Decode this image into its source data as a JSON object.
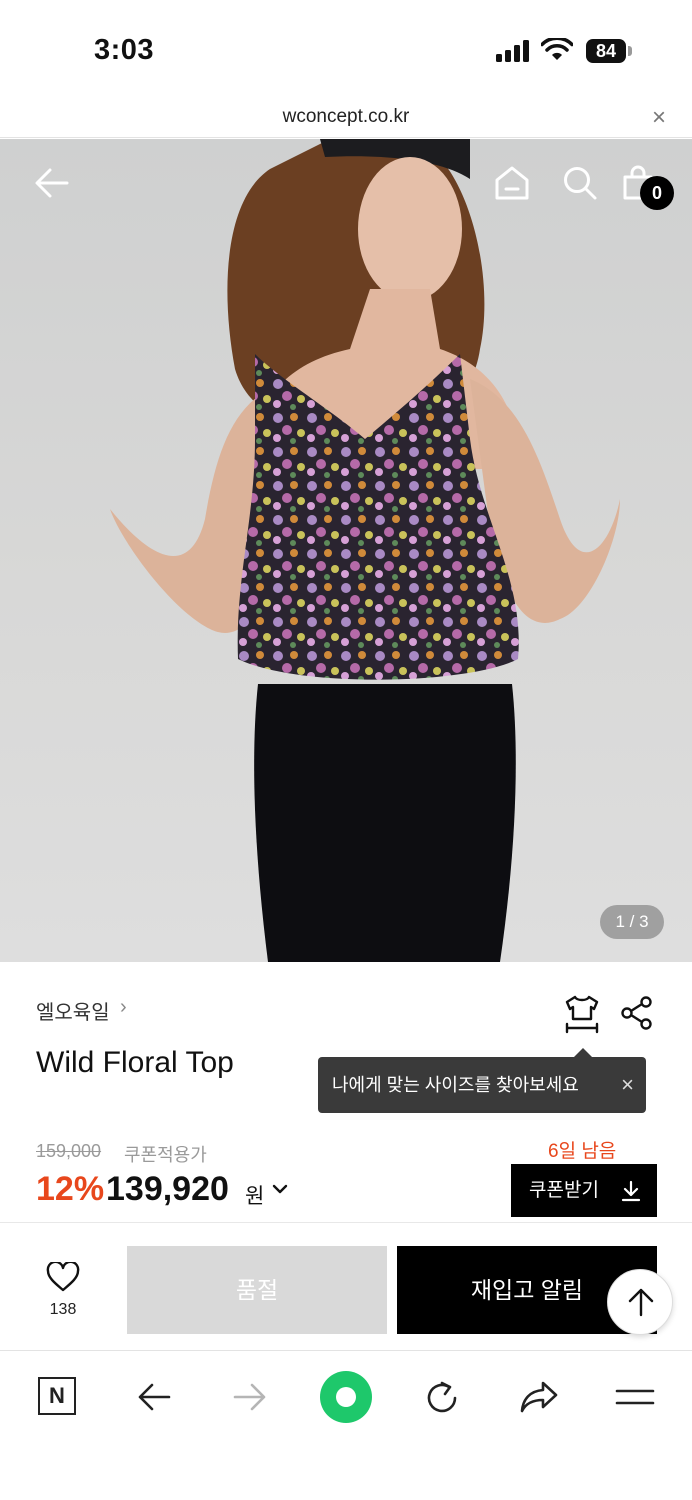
{
  "status_bar": {
    "time": "3:03",
    "battery": "84"
  },
  "url_bar": {
    "url": "wconcept.co.kr",
    "close": "×"
  },
  "product": {
    "brand": "엘오육일",
    "brand_chevron": "›",
    "title": "Wild Floral Top",
    "image_counter": "1 / 3",
    "cart_count": "0",
    "size_tooltip": "나에게 맞는 사이즈를 찾아보세요",
    "tooltip_close": "×"
  },
  "price": {
    "original": "159,000",
    "coupon_label": "쿠폰적용가",
    "discount": "12%",
    "final": "139,920",
    "currency": "원",
    "days_left": "6일 남음",
    "coupon_button": "쿠폰받기"
  },
  "actions": {
    "likes": "138",
    "soldout": "품절",
    "restock_alert": "재입고 알림"
  },
  "browser_nav": {
    "n_label": "N"
  },
  "colors": {
    "accent": "#e8471c",
    "green": "#1ec86b",
    "black": "#000000"
  }
}
